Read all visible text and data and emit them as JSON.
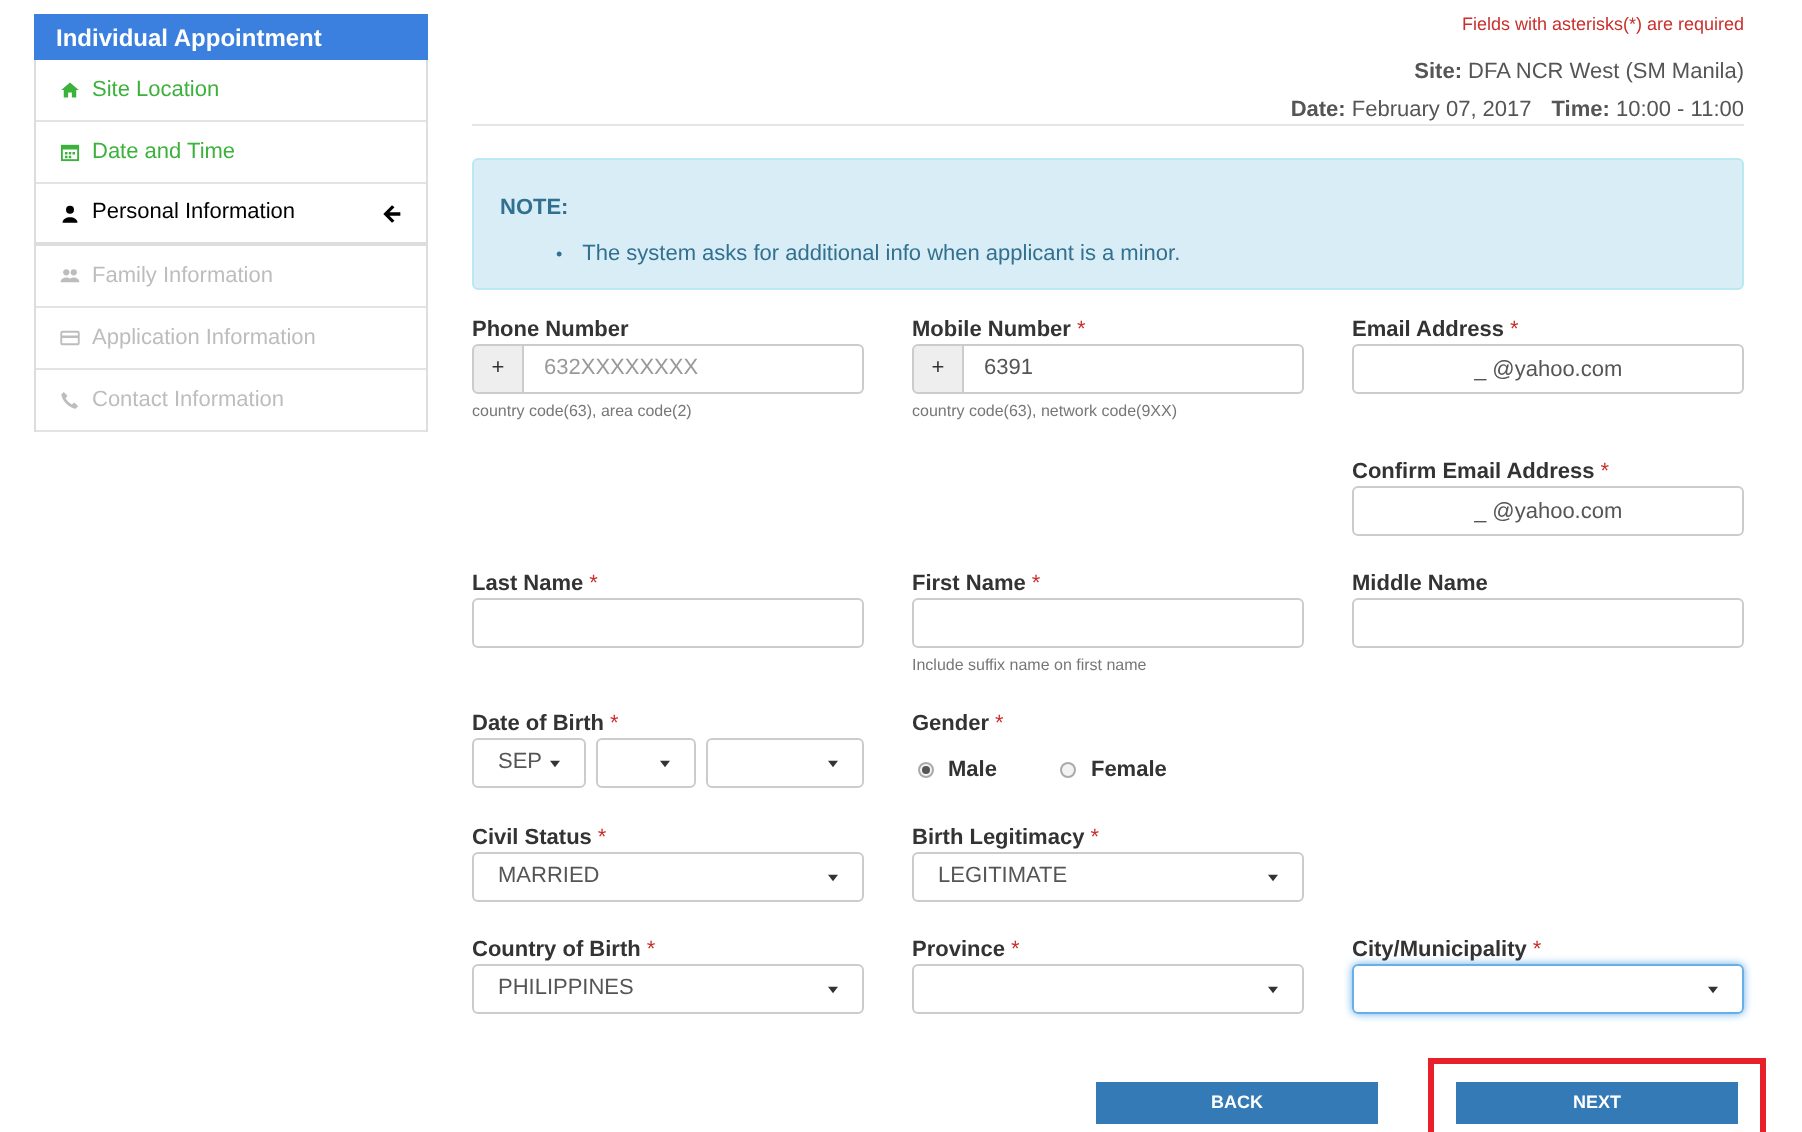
{
  "sidebar": {
    "title": "Individual Appointment",
    "items": [
      {
        "label": "Site Location",
        "selected": false,
        "disabled": false
      },
      {
        "label": "Date and Time",
        "selected": false,
        "disabled": false
      },
      {
        "label": "Personal Information",
        "selected": true,
        "disabled": false
      },
      {
        "label": "Family Information",
        "selected": false,
        "disabled": true
      },
      {
        "label": "Application Information",
        "selected": false,
        "disabled": true
      },
      {
        "label": "Contact Information",
        "selected": false,
        "disabled": true
      }
    ]
  },
  "required_notice": "Fields with asterisks(*) are required",
  "summary": [
    {
      "label": "Site:",
      "value": "DFA NCR West (SM Manila)"
    },
    {
      "label": "Date:",
      "value": "February 07, 2017"
    },
    {
      "label": "Time:",
      "value": "10:00 - 11:00"
    }
  ],
  "note": {
    "title": "NOTE:",
    "items": [
      {
        "bullet": "•",
        "text": "The system asks for additional info when applicant is a minor."
      }
    ]
  },
  "form_rows": [
    [
      {
        "kind": "prefixed",
        "label": "Phone Number",
        "prefix": "+",
        "placeholder": "632XXXXXXXX",
        "help": "country code(63), area code(2)"
      },
      {
        "kind": "prefixed",
        "label": "Mobile Number",
        "required_mark": "*",
        "prefix": "+",
        "value": "6391",
        "help": "country code(63), network code(9XX)"
      },
      {
        "kind": "text",
        "label": "Email Address",
        "required_mark": "*",
        "value": "_ @yahoo.com"
      }
    ],
    [
      null,
      null,
      {
        "kind": "text",
        "label": "Confirm Email Address",
        "required_mark": "*",
        "value": "_ @yahoo.com"
      }
    ],
    [
      {
        "kind": "text",
        "label": "Last Name",
        "required_mark": "*"
      },
      {
        "kind": "text",
        "label": "First Name",
        "required_mark": "*",
        "help": "Include suffix name on first name"
      },
      {
        "kind": "text",
        "label": "Middle Name"
      }
    ],
    [
      {
        "kind": "date",
        "label": "Date of Birth",
        "required_mark": "*",
        "value": "SEP"
      },
      {
        "kind": "radio",
        "label": "Gender",
        "required_mark": "*",
        "options": [
          {
            "label": "Male",
            "selected": true
          },
          {
            "label": "Female",
            "selected": false
          }
        ]
      },
      null
    ],
    [
      {
        "kind": "select",
        "label": "Civil Status",
        "required_mark": "*",
        "value": "MARRIED"
      },
      {
        "kind": "select",
        "label": "Birth Legitimacy",
        "required_mark": "*",
        "value": "LEGITIMATE"
      },
      null
    ],
    [
      {
        "kind": "select",
        "label": "Country of Birth",
        "required_mark": "*",
        "value": "PHILIPPINES"
      },
      {
        "kind": "select",
        "label": "Province",
        "required_mark": "*"
      },
      {
        "kind": "select",
        "label": "City/Municipality",
        "required_mark": "*",
        "focused": true
      }
    ]
  ],
  "buttons": [
    {
      "label": "BACK",
      "highlighted": false
    },
    {
      "label": "NEXT",
      "highlighted": true
    }
  ]
}
